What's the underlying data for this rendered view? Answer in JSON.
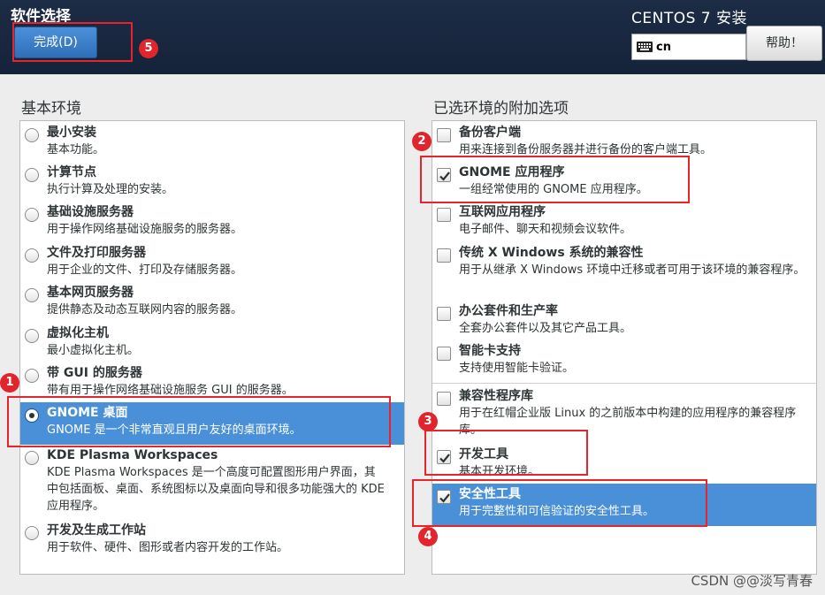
{
  "header": {
    "title": "软件选择",
    "done_label": "完成(D)",
    "product": "CENTOS 7 安装",
    "keyboard_layout": "cn",
    "help_label": "帮助！"
  },
  "left": {
    "heading": "基本环境",
    "items": [
      {
        "name": "最小安装",
        "desc": "基本功能。"
      },
      {
        "name": "计算节点",
        "desc": "执行计算及处理的安装。"
      },
      {
        "name": "基础设施服务器",
        "desc": "用于操作网络基础设施服务的服务器。"
      },
      {
        "name": "文件及打印服务器",
        "desc": "用于企业的文件、打印及存储服务器。"
      },
      {
        "name": "基本网页服务器",
        "desc": "提供静态及动态互联网内容的服务器。"
      },
      {
        "name": "虚拟化主机",
        "desc": "最小虚拟化主机。"
      },
      {
        "name": "带 GUI 的服务器",
        "desc": "带有用于操作网络基础设施服务 GUI 的服务器。"
      },
      {
        "name": "GNOME 桌面",
        "desc": "GNOME 是一个非常直观且用户友好的桌面环境。"
      },
      {
        "name": "KDE Plasma Workspaces",
        "desc": "KDE Plasma Workspaces 是一个高度可配置图形用户界面，其中包括面板、桌面、系统图标以及桌面向导和很多功能强大的 KDE 应用程序。"
      },
      {
        "name": "开发及生成工作站",
        "desc": "用于软件、硬件、图形或者内容开发的工作站。"
      }
    ]
  },
  "right": {
    "heading": "已选环境的附加选项",
    "items": [
      {
        "name": "备份客户端",
        "desc": "用来连接到备份服务器并进行备份的客户端工具。"
      },
      {
        "name": "GNOME 应用程序",
        "desc": "一组经常使用的 GNOME 应用程序。"
      },
      {
        "name": "互联网应用程序",
        "desc": "电子邮件、聊天和视频会议软件。"
      },
      {
        "name": "传统 X Windows 系统的兼容性",
        "desc": "用于从继承 X Windows 环境中迁移或者可用于该环境的兼容程序。"
      },
      {
        "name": "办公套件和生产率",
        "desc": "全套办公套件以及其它产品工具。"
      },
      {
        "name": "智能卡支持",
        "desc": "支持使用智能卡验证。"
      },
      {
        "name": "兼容性程序库",
        "desc": "用于在红帽企业版 Linux 的之前版本中构建的应用程序的兼容程序库。"
      },
      {
        "name": "开发工具",
        "desc": "基本开发环境。"
      },
      {
        "name": "安全性工具",
        "desc": "用于完整性和可信验证的安全性工具。"
      }
    ]
  },
  "annotations": [
    "1",
    "2",
    "3",
    "4",
    "5"
  ],
  "watermark": "CSDN @@淡写青春",
  "colors": {
    "selection": "#4a90d9",
    "header": "#1d2c45",
    "annotation": "#e0262c"
  }
}
